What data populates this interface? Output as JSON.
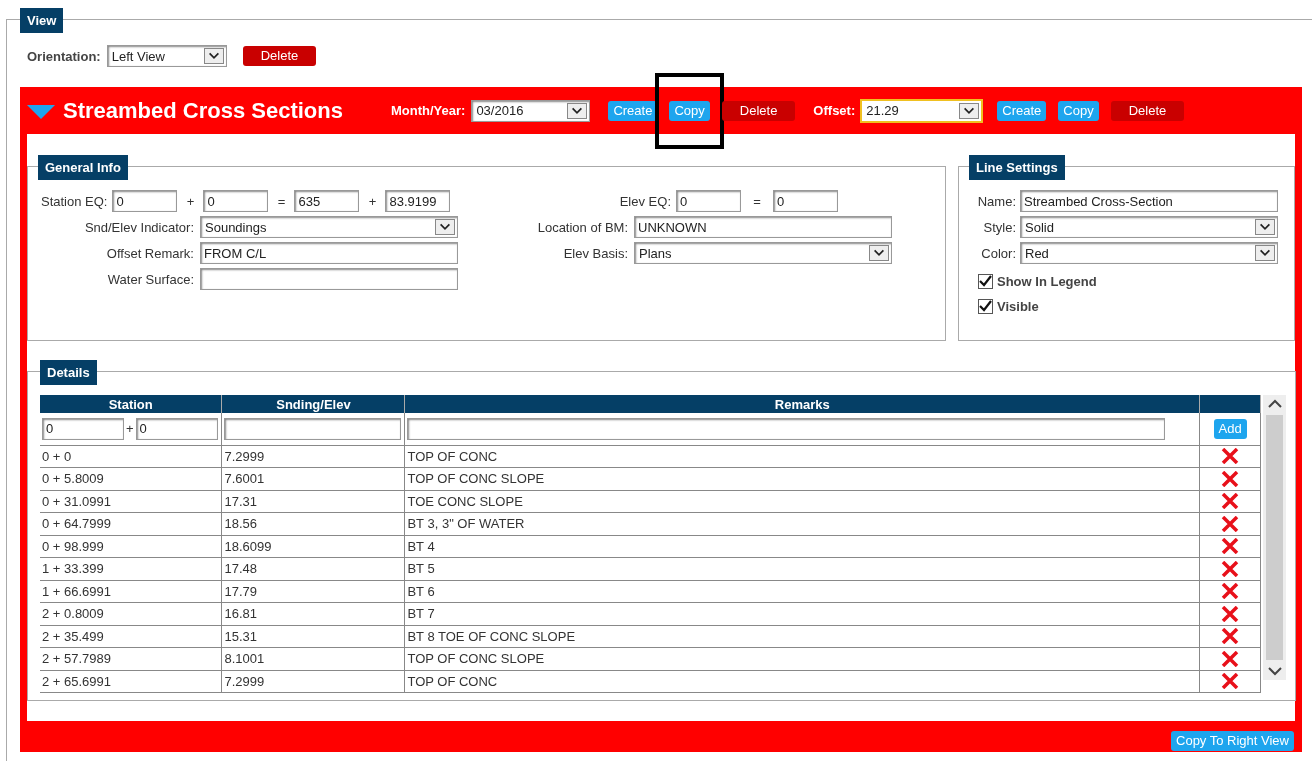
{
  "view": {
    "legend": "View",
    "orientation": {
      "label": "Orientation:",
      "value": "Left View"
    },
    "delete_button": "Delete"
  },
  "section": {
    "title": "Streambed Cross Sections",
    "expanded": true,
    "month_year": {
      "label": "Month/Year:",
      "value": "03/2016",
      "focused": false
    },
    "month_buttons": [
      {
        "kind": "create",
        "label": "Create",
        "highlighted": false
      },
      {
        "kind": "copy",
        "label": "Copy",
        "highlighted": true
      },
      {
        "kind": "delete",
        "label": "Delete",
        "highlighted": false
      }
    ],
    "offset": {
      "label": "Offset:",
      "value": "21.29",
      "focused": true
    },
    "offset_buttons": [
      {
        "kind": "create",
        "label": "Create",
        "highlighted": false
      },
      {
        "kind": "copy",
        "label": "Copy",
        "highlighted": false
      },
      {
        "kind": "delete",
        "label": "Delete",
        "highlighted": false
      }
    ]
  },
  "general_info": {
    "legend": "General Info",
    "station_eq": {
      "label": "Station EQ:",
      "values": [
        "0",
        "0",
        "635",
        "83.9199"
      ],
      "operators": [
        "+",
        "=",
        "+"
      ]
    },
    "left_fields": [
      {
        "kind": "select",
        "label": "Snd/Elev Indicator:",
        "value": "Soundings"
      },
      {
        "kind": "input",
        "label": "Offset Remark:",
        "value": "FROM C/L"
      },
      {
        "kind": "input",
        "label": "Water Surface:"
      }
    ],
    "elev_eq": {
      "label": "Elev EQ:",
      "values": [
        "0",
        "0"
      ],
      "operators": [
        "="
      ]
    },
    "right_fields": [
      {
        "kind": "input",
        "label": "Location of BM:",
        "value": "UNKNOWN"
      },
      {
        "kind": "select",
        "label": "Elev Basis:",
        "value": "Plans"
      }
    ]
  },
  "line_settings": {
    "legend": "Line Settings",
    "fields": [
      {
        "kind": "input",
        "label": "Name:",
        "value": "Streambed Cross-Section"
      },
      {
        "kind": "select",
        "label": "Style:",
        "value": "Solid"
      },
      {
        "kind": "select",
        "label": "Color:",
        "value": "Red"
      }
    ],
    "checkboxes": [
      {
        "label": "Show In Legend",
        "checked": true
      },
      {
        "label": "Visible",
        "checked": true
      }
    ]
  },
  "details": {
    "legend": "Details",
    "columns": [
      "Station",
      "Snding/Elev",
      "Remarks"
    ],
    "new_row": {
      "station_start": "0",
      "operator": "+",
      "station_plus": "0"
    },
    "add_button": "Add",
    "rows": [
      {
        "station": "0 + 0",
        "elev": "7.2999",
        "remarks": "TOP OF CONC"
      },
      {
        "station": "0 + 5.8009",
        "elev": "7.6001",
        "remarks": "TOP OF CONC SLOPE"
      },
      {
        "station": "0 + 31.0991",
        "elev": "17.31",
        "remarks": "TOE CONC SLOPE"
      },
      {
        "station": "0 + 64.7999",
        "elev": "18.56",
        "remarks": "BT 3, 3\" OF WATER"
      },
      {
        "station": "0 + 98.999",
        "elev": "18.6099",
        "remarks": "BT 4"
      },
      {
        "station": "1 + 33.399",
        "elev": "17.48",
        "remarks": "BT 5"
      },
      {
        "station": "1 + 66.6991",
        "elev": "17.79",
        "remarks": "BT 6"
      },
      {
        "station": "2 + 0.8009",
        "elev": "16.81",
        "remarks": "BT 7"
      },
      {
        "station": "2 + 35.499",
        "elev": "15.31",
        "remarks": "BT 8 TOE OF CONC SLOPE"
      },
      {
        "station": "2 + 57.7989",
        "elev": "8.1001",
        "remarks": "TOP OF CONC SLOPE"
      },
      {
        "station": "2 + 65.6991",
        "elev": "7.2999",
        "remarks": "TOP OF CONC"
      }
    ]
  },
  "footer": {
    "copy_button": "Copy To Right View"
  }
}
